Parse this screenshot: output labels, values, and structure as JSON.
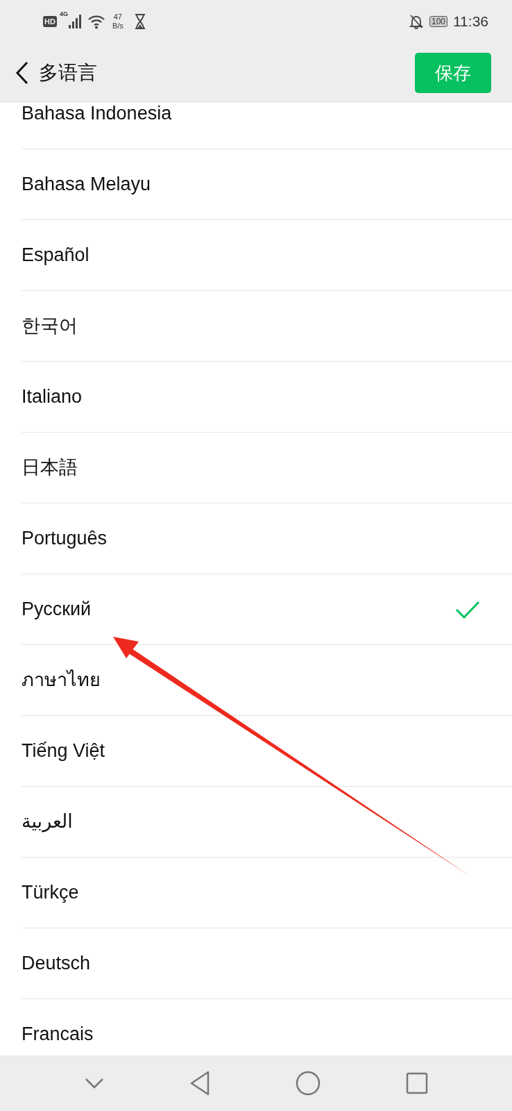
{
  "status_bar": {
    "hd": "HD",
    "network": "4G",
    "speed": "47",
    "speed_unit": "B/s",
    "battery": "100",
    "time": "11:36"
  },
  "header": {
    "title": "多语言",
    "save_button": "保存"
  },
  "languages": [
    {
      "label": "Bahasa Indonesia",
      "selected": false
    },
    {
      "label": "Bahasa Melayu",
      "selected": false
    },
    {
      "label": "Español",
      "selected": false
    },
    {
      "label": "한국어",
      "selected": false
    },
    {
      "label": "Italiano",
      "selected": false
    },
    {
      "label": "日本語",
      "selected": false
    },
    {
      "label": "Português",
      "selected": false
    },
    {
      "label": "Русский",
      "selected": true
    },
    {
      "label": "ภาษาไทย",
      "selected": false
    },
    {
      "label": "Tiếng Việt",
      "selected": false
    },
    {
      "label": "العربية",
      "selected": false
    },
    {
      "label": "Türkçe",
      "selected": false
    },
    {
      "label": "Deutsch",
      "selected": false
    },
    {
      "label": "Francais",
      "selected": false
    }
  ],
  "annotation": {
    "kind": "arrow"
  }
}
